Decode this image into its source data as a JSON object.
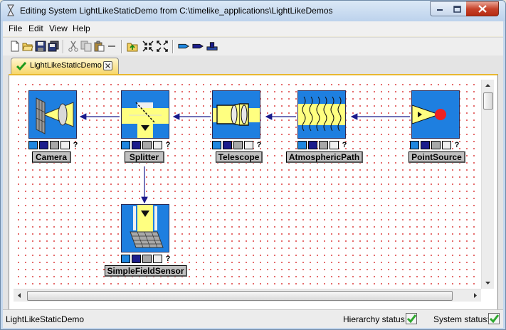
{
  "window": {
    "title": "Editing System LightLikeStaticDemo from C:\\timelike_applications\\LightLikeDemos"
  },
  "menu": {
    "items": [
      "File",
      "Edit",
      "View",
      "Help"
    ]
  },
  "toolbar": {
    "buttons": [
      "new-icon",
      "open-icon",
      "save-icon",
      "save-all-icon",
      "cut-icon",
      "copy-icon",
      "paste-icon",
      "delete-icon",
      "go-up-icon",
      "collapse-icon",
      "expand-icon",
      "input-port-icon",
      "output-port-icon",
      "run-icon"
    ]
  },
  "tab": {
    "label": "LightLikeStaticDemo"
  },
  "diagram": {
    "blocks": [
      {
        "label": "Camera",
        "icon": "camera-icon"
      },
      {
        "label": "Splitter",
        "icon": "splitter-icon"
      },
      {
        "label": "Telescope",
        "icon": "telescope-icon"
      },
      {
        "label": "AtmosphericPath",
        "icon": "atmospheric-path-icon"
      },
      {
        "label": "PointSource",
        "icon": "point-source-icon"
      },
      {
        "label": "SimpleFieldSensor",
        "icon": "field-sensor-icon"
      }
    ],
    "port_help": "?",
    "connections": [
      {
        "from": "PointSource",
        "to": "AtmosphericPath"
      },
      {
        "from": "AtmosphericPath",
        "to": "Telescope"
      },
      {
        "from": "Telescope",
        "to": "Splitter"
      },
      {
        "from": "Splitter",
        "to": "Camera"
      },
      {
        "from": "Splitter",
        "to": "SimpleFieldSensor"
      }
    ]
  },
  "status": {
    "system_name": "LightLikeStaticDemo",
    "hierarchy_label": "Hierarchy status:",
    "hierarchy_ok": true,
    "system_label": "System status:",
    "system_ok": true
  },
  "colors": {
    "block_bg": "#1e7fe0",
    "beam_yellow": "#ffff80",
    "connection": "#1a1a8c",
    "status_ok": "#2ea82e"
  }
}
